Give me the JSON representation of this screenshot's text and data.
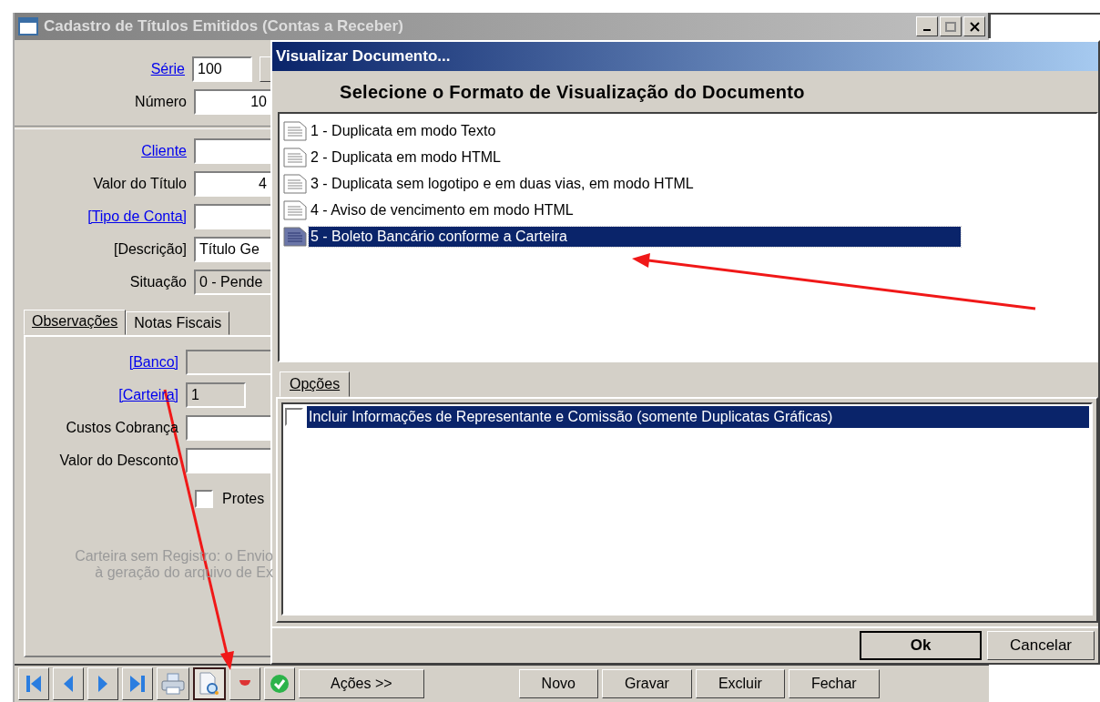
{
  "main_window": {
    "title": "Cadastro de Títulos Emitidos (Contas a Receber)",
    "top_fields": [
      {
        "label": "Série",
        "kind": "link",
        "value": "100",
        "numeric": false,
        "disabled": false,
        "lookup": true
      },
      {
        "label": "Número",
        "kind": "plain",
        "value": "10",
        "numeric": true,
        "disabled": false,
        "lookup": false
      }
    ],
    "fields": [
      {
        "label": "Cliente",
        "kind": "link",
        "disabled": false
      },
      {
        "label": "Valor do Título",
        "kind": "plain",
        "value": "4",
        "numeric": true,
        "disabled": false
      },
      {
        "label": "[Tipo de Conta]",
        "kind": "link",
        "disabled": false
      },
      {
        "label": "[Descrição]",
        "kind": "plain",
        "value": "Título Ge",
        "numeric": false,
        "disabled": false
      },
      {
        "label": "Situação",
        "kind": "plain",
        "value": "0 - Pende",
        "numeric": false,
        "disabled": true
      }
    ],
    "tabs": [
      {
        "label": "Observações",
        "selected": true
      },
      {
        "label": "Notas Fiscais",
        "selected": false
      }
    ],
    "tab_fields": [
      {
        "label": "[Banco]",
        "kind": "link",
        "disabled": true
      },
      {
        "label": "[Carteira]",
        "kind": "link",
        "value": "1",
        "disabled": true
      },
      {
        "label": "Custos Cobrança",
        "kind": "plain",
        "disabled": false
      },
      {
        "label": "Valor do Desconto",
        "kind": "plain",
        "disabled": false
      }
    ],
    "protest_checkbox": {
      "label": "Protes",
      "checked": false
    },
    "note_lines": [
      "Carteira sem Registro: o Envio",
      "à geração do arquivo de Ex"
    ],
    "toolbar_icons": [
      {
        "kind": "first",
        "pressed": false
      },
      {
        "kind": "prev",
        "pressed": false
      },
      {
        "kind": "next",
        "pressed": false
      },
      {
        "kind": "last",
        "pressed": false
      },
      {
        "kind": "print",
        "pressed": false
      },
      {
        "kind": "preview",
        "pressed": true
      },
      {
        "kind": "cancel",
        "pressed": false
      },
      {
        "kind": "confirm",
        "pressed": false
      }
    ],
    "toolbar_buttons": [
      "Ações >>",
      "Novo",
      "Gravar",
      "Excluir",
      "Fechar"
    ]
  },
  "dialog": {
    "title": "Visualizar Documento...",
    "heading": "Selecione o Formato de Visualização do Documento",
    "formats": [
      {
        "label": "1 - Duplicata em modo Texto",
        "selected": false
      },
      {
        "label": "2 - Duplicata em modo HTML",
        "selected": false
      },
      {
        "label": "3 - Duplicata sem logotipo e em duas vias, em modo HTML",
        "selected": false
      },
      {
        "label": "4 - Aviso de vencimento em modo HTML",
        "selected": false
      },
      {
        "label": "5 - Boleto Bancário conforme a Carteira",
        "selected": true
      }
    ],
    "tabs": [
      {
        "label": "Opções",
        "selected": true
      }
    ],
    "options": [
      {
        "label": "Incluir Informações de Representante e Comissão (somente Duplicatas Gráficas)",
        "checked": false,
        "selected": true
      }
    ],
    "buttons": [
      {
        "label": "Ok",
        "default": true
      },
      {
        "label": "Cancelar",
        "default": false
      }
    ]
  }
}
